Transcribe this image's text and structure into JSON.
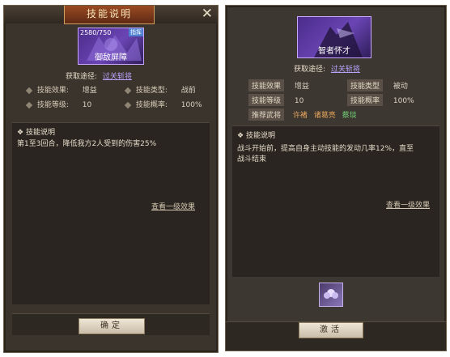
{
  "left": {
    "title": "技能说明",
    "close": "✕",
    "card": {
      "count": "2580/750",
      "badge": "指挥",
      "name": "御敌屏障"
    },
    "acquire_label": "获取途径:",
    "acquire_link": "过关斩将",
    "props": {
      "effect_label": "技能效果:",
      "effect_value": "增益",
      "type_label": "技能类型:",
      "type_value": "战前",
      "level_label": "技能等级:",
      "level_value": "10",
      "rate_label": "技能概率:",
      "rate_value": "100%"
    },
    "desc_title": "技能说明",
    "desc_text": "第1至3回合，降低我方2人受到的伤害25%",
    "more": "查看一级效果",
    "confirm": "确定"
  },
  "right": {
    "card": {
      "name": "智者怀才"
    },
    "acquire_label": "获取途径:",
    "acquire_link": "过关斩将",
    "props": {
      "effect_label": "技能效果",
      "effect_value": "增益",
      "type_label": "技能类型",
      "type_value": "被动",
      "level_label": "技能等级",
      "level_value": "10",
      "rate_label": "技能概率",
      "rate_value": "100%",
      "rec_label": "推荐武将",
      "rec_generals": [
        "许褚",
        "诸葛亮",
        "蔡琰"
      ]
    },
    "desc_title": "技能说明",
    "desc_text_1": "战斗开始前，提高自身主动技能的发动几率12%，直至",
    "desc_text_2": "战斗结束",
    "more": "查看一级效果",
    "activate": "激活"
  },
  "colors": {
    "accent_link": "#b7a4ff",
    "card_purple": "#6a45b4",
    "rec_orange": "#e5a35a",
    "rec_green": "#6ecb74"
  }
}
